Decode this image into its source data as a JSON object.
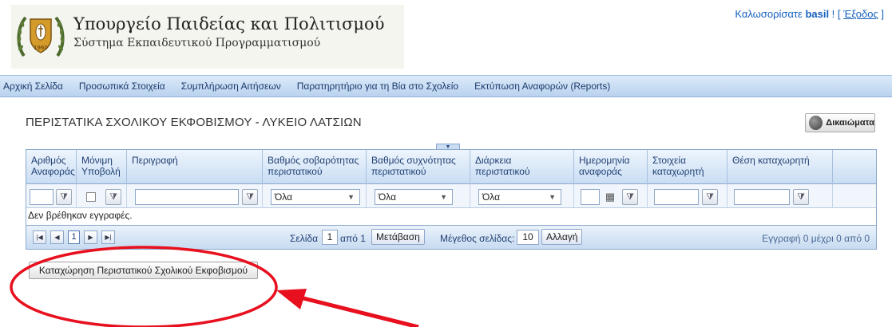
{
  "header": {
    "title": "Υπουργείο Παιδείας και Πολιτισμού",
    "subtitle": "Σύστημα Εκπαιδευτικού Προγραμματισμού",
    "welcome_prefix": "Καλωσορίσατε ",
    "username": "basil",
    "welcome_sep": " ! [ ",
    "logout_label": "Έξοδος",
    "welcome_suffix": " ]"
  },
  "nav": {
    "items": [
      {
        "label": "Αρχική Σελίδα"
      },
      {
        "label": "Προσωπικά Στοιχεία"
      },
      {
        "label": "Συμπλήρωση Αιτήσεων"
      },
      {
        "label": "Παρατηρητήριο για τη Βία στο Σχολείο"
      },
      {
        "label": "Εκτύπωση Αναφορών (Reports)"
      }
    ]
  },
  "page": {
    "title": "ΠΕΡΙΣΤΑΤΙΚΑ ΣΧΟΛΙΚΟΥ ΕΚΦΟΒΙΣΜΟΥ - ΛΥΚΕΙΟ ΛΑΤΣΙΩΝ",
    "rights_label": "Δικαιώματα"
  },
  "grid": {
    "columns": [
      {
        "line1": "Αριθμός",
        "line2": "Αναφοράς"
      },
      {
        "line1": "Μόνιμη",
        "line2": "Υποβολή"
      },
      {
        "line1": "Περιγραφή",
        "line2": ""
      },
      {
        "line1": "Βαθμός σοβαρότητας",
        "line2": "περιστατικού"
      },
      {
        "line1": "Βαθμός συχνότητας",
        "line2": "περιστατικού"
      },
      {
        "line1": "Διάρκεια",
        "line2": "περιστατικού"
      },
      {
        "line1": "Ημερομηνία",
        "line2": "αναφοράς"
      },
      {
        "line1": "Στοιχεία",
        "line2": "καταχωρητή"
      },
      {
        "line1": "Θέση καταχωρητή",
        "line2": ""
      }
    ],
    "filters": {
      "severity": "Όλα",
      "frequency": "Όλα",
      "duration": "Όλα"
    },
    "no_records": "Δεν βρέθηκαν εγγραφές.",
    "pager": {
      "current_page": "1",
      "page_label": "Σελίδα",
      "page_input": "1",
      "of_label": "από 1",
      "go_label": "Μετάβαση",
      "size_label": "Μέγεθος σελίδας:",
      "size_value": "10",
      "change_label": "Αλλαγή",
      "info": "Εγγραφή 0 μέχρι 0 από 0"
    }
  },
  "register_button": "Καταχώρηση Περιστατικού Σχολικού Εκφοβισμού",
  "colors": {
    "link": "#1560bd",
    "nav_bg": "#c9ddf3",
    "annotation": "#e8101e"
  }
}
